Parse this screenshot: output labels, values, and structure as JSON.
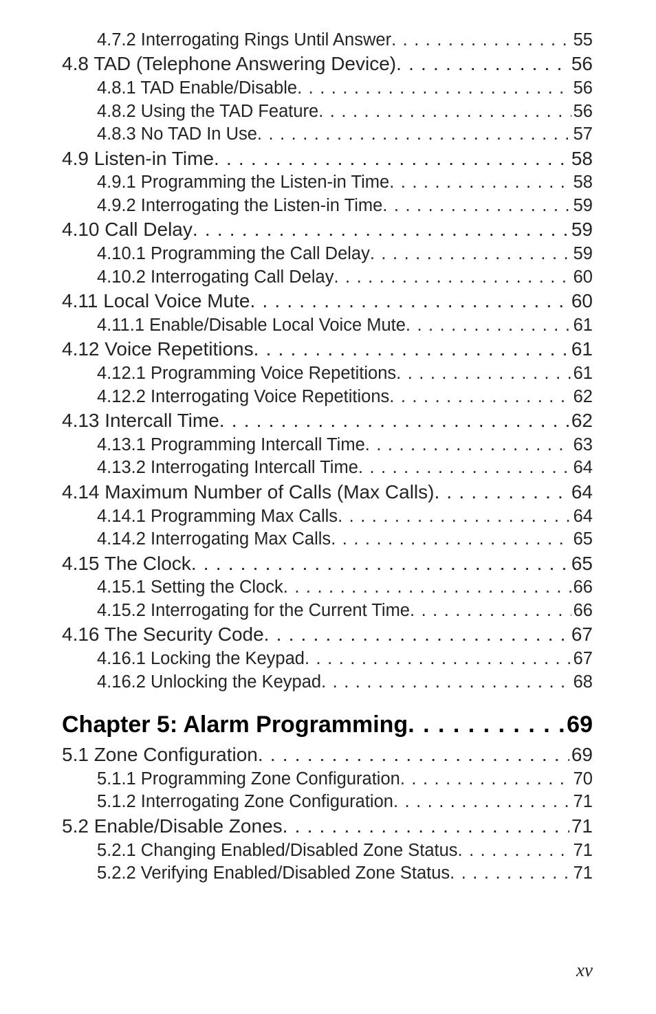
{
  "entries": [
    {
      "kind": "sub",
      "title": "4.7.2  Interrogating Rings Until Answer",
      "page": "55"
    },
    {
      "kind": "section",
      "title": "4.8  TAD (Telephone Answering  Device)",
      "page": "56"
    },
    {
      "kind": "sub",
      "title": "4.8.1  TAD Enable/Disable",
      "page": "56"
    },
    {
      "kind": "sub",
      "title": "4.8.2  Using the TAD Feature",
      "page": "56"
    },
    {
      "kind": "sub",
      "title": "4.8.3  No TAD In Use",
      "page": "57"
    },
    {
      "kind": "section",
      "title": "4.9  Listen-in Time",
      "page": "58"
    },
    {
      "kind": "sub",
      "title": "4.9.1  Programming the Listen-in Time",
      "page": "58"
    },
    {
      "kind": "sub",
      "title": "4.9.2  Interrogating the Listen-in Time",
      "page": "59"
    },
    {
      "kind": "section",
      "title": "4.10  Call Delay",
      "page": "59"
    },
    {
      "kind": "sub",
      "title": "4.10.1  Programming the Call Delay",
      "page": "59"
    },
    {
      "kind": "sub",
      "title": "4.10.2  Interrogating Call Delay",
      "page": "60"
    },
    {
      "kind": "section",
      "title": "4.11  Local Voice Mute",
      "page": "60"
    },
    {
      "kind": "sub",
      "title": "4.11.1  Enable/Disable Local Voice Mute",
      "page": "61"
    },
    {
      "kind": "section",
      "title": "4.12  Voice Repetitions",
      "page": "61"
    },
    {
      "kind": "sub",
      "title": "4.12.1  Programming Voice Repetitions",
      "page": "61"
    },
    {
      "kind": "sub",
      "title": "4.12.2  Interrogating Voice Repetitions",
      "page": "62"
    },
    {
      "kind": "section",
      "title": "4.13  Intercall Time",
      "page": "62"
    },
    {
      "kind": "sub",
      "title": "4.13.1  Programming Intercall Time",
      "page": "63"
    },
    {
      "kind": "sub",
      "title": "4.13.2  Interrogating Intercall Time",
      "page": "64"
    },
    {
      "kind": "section",
      "title": "4.14  Maximum Number of Calls (Max Calls)",
      "page": "64"
    },
    {
      "kind": "sub",
      "title": "4.14.1  Programming Max Calls",
      "page": "64"
    },
    {
      "kind": "sub",
      "title": "4.14.2  Interrogating Max Calls",
      "page": "65"
    },
    {
      "kind": "section",
      "title": "4.15  The Clock",
      "page": "65"
    },
    {
      "kind": "sub",
      "title": "4.15.1  Setting the Clock",
      "page": "66"
    },
    {
      "kind": "sub",
      "title": "4.15.2  Interrogating for the Current Time",
      "page": "66"
    },
    {
      "kind": "section",
      "title": "4.16  The Security Code",
      "page": "67"
    },
    {
      "kind": "sub",
      "title": "4.16.1  Locking the Keypad",
      "page": "67"
    },
    {
      "kind": "sub",
      "title": "4.16.2  Unlocking the Keypad",
      "page": "68"
    },
    {
      "kind": "chapter",
      "title": "Chapter 5: Alarm Programming",
      "page": "69"
    },
    {
      "kind": "section",
      "title": "5.1  Zone Configuration",
      "page": "69"
    },
    {
      "kind": "sub",
      "title": "5.1.1  Programming Zone Configuration",
      "page": "70"
    },
    {
      "kind": "sub",
      "title": "5.1.2  Interrogating Zone Configuration",
      "page": "71"
    },
    {
      "kind": "section",
      "title": "5.2  Enable/Disable Zones",
      "page": "71"
    },
    {
      "kind": "sub",
      "title": "5.2.1  Changing Enabled/Disabled Zone Status",
      "page": "71"
    },
    {
      "kind": "sub",
      "title": "5.2.2  Verifying Enabled/Disabled Zone Status",
      "page": "71"
    }
  ],
  "folio": "xv"
}
